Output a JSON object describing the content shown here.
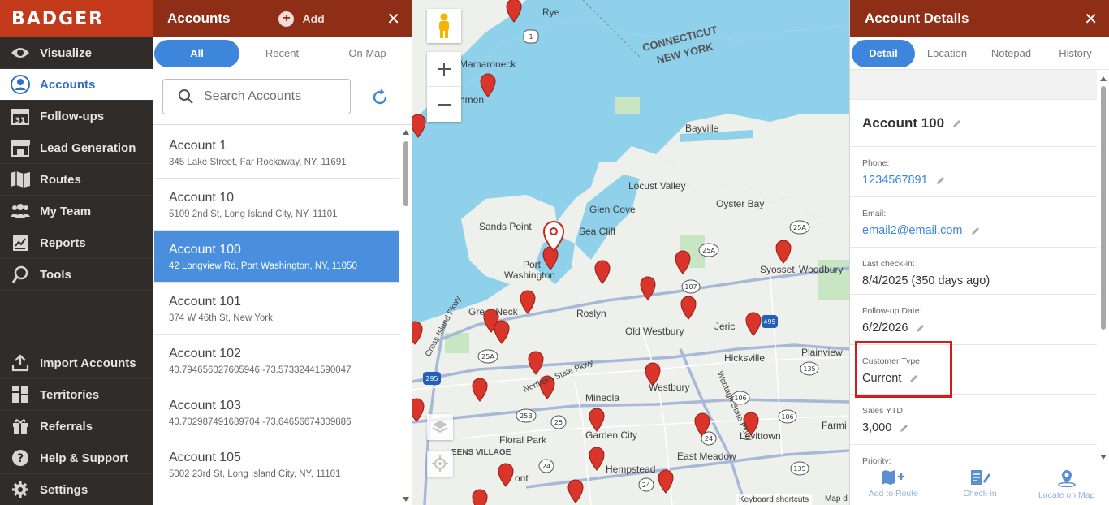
{
  "brand": {
    "logo_text": "BADGER",
    "accent": "#c23a1a",
    "nav_bg": "#2f2c2a"
  },
  "nav": {
    "items": [
      {
        "label": "Visualize",
        "icon": "eye-icon"
      },
      {
        "label": "Accounts",
        "icon": "user-circle-icon",
        "active": true
      },
      {
        "label": "Follow-ups",
        "icon": "calendar-icon"
      },
      {
        "label": "Lead Generation",
        "icon": "storefront-icon"
      },
      {
        "label": "Routes",
        "icon": "map-icon"
      },
      {
        "label": "My Team",
        "icon": "team-icon"
      },
      {
        "label": "Reports",
        "icon": "report-icon"
      },
      {
        "label": "Tools",
        "icon": "tools-icon"
      }
    ],
    "bottom_items": [
      {
        "label": "Import Accounts",
        "icon": "upload-icon"
      },
      {
        "label": "Territories",
        "icon": "territories-icon"
      },
      {
        "label": "Referrals",
        "icon": "gift-icon"
      },
      {
        "label": "Help & Support",
        "icon": "help-icon"
      },
      {
        "label": "Settings",
        "icon": "gear-icon"
      }
    ]
  },
  "accounts_panel": {
    "title": "Accounts",
    "add_label": "Add",
    "tabs": [
      "All",
      "Recent",
      "On Map"
    ],
    "active_tab": "All",
    "search_placeholder": "Search Accounts",
    "list": [
      {
        "name": "Account 1",
        "address": "345 Lake Street, Far Rockaway, NY, 11691"
      },
      {
        "name": "Account 10",
        "address": "5109 2nd St, Long Island City, NY, 11101"
      },
      {
        "name": "Account 100",
        "address": "42 Longview Rd, Port Washington, NY, 11050",
        "selected": true
      },
      {
        "name": "Account 101",
        "address": "374 W 46th St, New York"
      },
      {
        "name": "Account 102",
        "address": "40.794656027605946,-73.57332441590047"
      },
      {
        "name": "Account 103",
        "address": "40.702987491689704,-73.64656674309886"
      },
      {
        "name": "Account 105",
        "address": "5002 23rd St, Long Island City, NY, 11101"
      }
    ]
  },
  "map": {
    "labels": {
      "rye": "Rye",
      "mamaroneck": "Mamaroneck",
      "rochelle": "hmon",
      "ct": "CONNECTICUT",
      "ny": "NEW YORK",
      "bayville": "Bayville",
      "locust": "Locust Valley",
      "glencove": "Glen Cove",
      "oysterbay": "Oyster Bay",
      "sandspoint": "Sands Point",
      "seacliff": "Sea Cliff",
      "port": "Port",
      "washington": "Washington",
      "syosset": "Syosset",
      "woodbury": "Woodbury",
      "greatneck": "Gre    Neck",
      "roslyn": "Roslyn",
      "oldwestbury": "Old Westbury",
      "jericho": "Jeric",
      "hicksville": "Hicksville",
      "plainview": "Plainview",
      "mineola": "Mineola",
      "westbury": "Westbury",
      "floralpark": "Floral Park",
      "gardencity": "Garden City",
      "levittown": "Levittown",
      "farmi": "Farmi",
      "eensvillage": "EENS VILLAGE",
      "ont": "ont",
      "hempstead": "Hempstead",
      "eastmeadow": "East Meadow",
      "crossisland": "Cross Island Pkwy",
      "northernstate": "Northern State Pkwy",
      "wantagh": "Wantagh State Pkwy",
      "shortcuts": "Keyboard shortcuts",
      "mapdata": "Map d"
    },
    "shields": [
      "1",
      "25A",
      "107",
      "25A",
      "25A",
      "495",
      "295",
      "25A",
      "135",
      "106",
      "25B",
      "25",
      "24",
      "106",
      "24",
      "135",
      "24"
    ]
  },
  "details": {
    "title": "Account Details",
    "tabs": [
      "Detail",
      "Location",
      "Notepad",
      "History"
    ],
    "active_tab": "Detail",
    "account_name": "Account 100",
    "fields": {
      "phone_label": "Phone:",
      "phone": "1234567891",
      "email_label": "Email:",
      "email": "email2@email.com",
      "checkin_label": "Last check-in:",
      "checkin": "8/4/2025 (350 days ago)",
      "followup_label": "Follow-up Date:",
      "followup": "6/2/2026",
      "customer_type_label": "Customer Type:",
      "customer_type": "Current",
      "sales_label": "Sales YTD:",
      "sales": "3,000",
      "priority_label": "Priority:"
    },
    "footer": [
      {
        "label": "Add to Route",
        "icon": "map-plus-icon"
      },
      {
        "label": "Check-in",
        "icon": "checkin-icon"
      },
      {
        "label": "Locate on Map",
        "icon": "locate-pin-icon"
      }
    ]
  }
}
